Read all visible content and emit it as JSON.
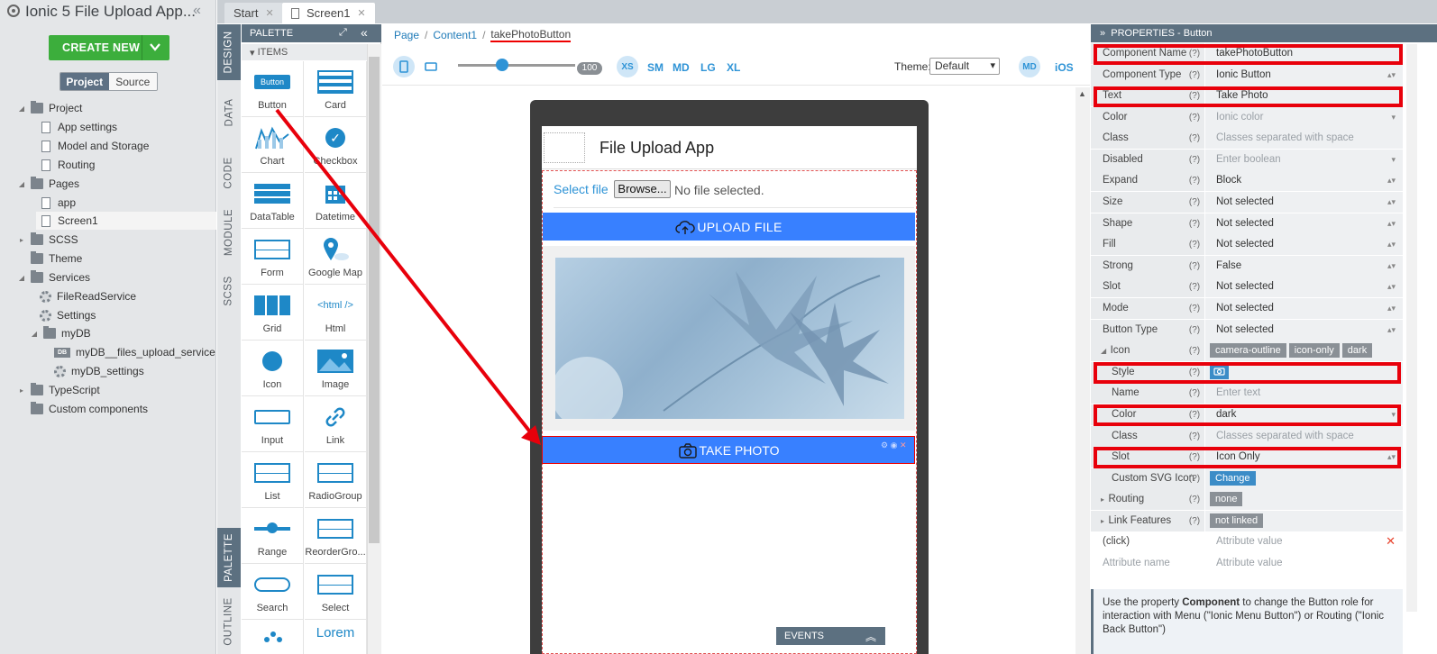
{
  "project": {
    "title": "Ionic 5 File Upload App...",
    "create_new": "CREATE NEW",
    "tab_project": "Project",
    "tab_source": "Source",
    "tree": [
      {
        "label": "Project",
        "icon": "folder-icon",
        "expanded": true
      },
      {
        "label": "App settings",
        "icon": "file-icon"
      },
      {
        "label": "Model and Storage",
        "icon": "file-icon"
      },
      {
        "label": "Routing",
        "icon": "file-icon"
      },
      {
        "label": "Pages",
        "icon": "folder-icon",
        "expanded": true
      },
      {
        "label": "app",
        "icon": "file-icon"
      },
      {
        "label": "Screen1",
        "icon": "file-icon",
        "selected": true
      },
      {
        "label": "SCSS",
        "icon": "folder-icon"
      },
      {
        "label": "Theme",
        "icon": "folder-icon"
      },
      {
        "label": "Services",
        "icon": "folder-icon",
        "expanded": true
      },
      {
        "label": "FileReadService",
        "icon": "gear-icon"
      },
      {
        "label": "Settings",
        "icon": "gear-icon"
      },
      {
        "label": "myDB",
        "icon": "folder-icon",
        "expanded": true
      },
      {
        "label": "myDB__files_upload_service",
        "icon": "db-icon",
        "badge": "DB"
      },
      {
        "label": "myDB_settings",
        "icon": "gear-icon"
      },
      {
        "label": "TypeScript",
        "icon": "folder-icon"
      },
      {
        "label": "Custom components",
        "icon": "folder-icon"
      }
    ]
  },
  "tabs": [
    {
      "label": "Start"
    },
    {
      "label": "Screen1"
    }
  ],
  "vtabs": {
    "design": "DESIGN",
    "data": "DATA",
    "code": "CODE",
    "module": "MODULE",
    "scss": "SCSS",
    "palette": "PALETTE",
    "outline": "OUTLINE"
  },
  "palette": {
    "title": "PALETTE",
    "items_header": "ITEMS",
    "button_pic": "Button",
    "html_pic": "<html />",
    "lorem": "Lorem",
    "items": [
      "Button",
      "Card",
      "Chart",
      "Checkbox",
      "DataTable",
      "Datetime",
      "Form",
      "Google Map",
      "Grid",
      "Html",
      "Icon",
      "Image",
      "Input",
      "Link",
      "List",
      "RadioGroup",
      "Range",
      "ReorderGro...",
      "Search",
      "Select"
    ]
  },
  "breadcrumb": [
    "Page",
    "Content1",
    "takePhotoButton"
  ],
  "toolbar": {
    "zoom": "100",
    "sizes": [
      "XS",
      "SM",
      "MD",
      "LG",
      "XL"
    ],
    "theme_label": "Theme:",
    "theme_value": "Default",
    "mode_md": "MD",
    "mode_ios": "iOS"
  },
  "preview": {
    "header_title": "File Upload App",
    "select_file": "Select file",
    "browse": "Browse...",
    "no_file": "No file selected.",
    "upload_button": "UPLOAD FILE",
    "take_photo_button": "TAKE PHOTO",
    "events": "EVENTS"
  },
  "properties": {
    "title": "PROPERTIES - Button",
    "rows": [
      {
        "label": "Component Name",
        "value": "takePhotoButton"
      },
      {
        "label": "Component Type",
        "value": "Ionic Button"
      },
      {
        "label": "Text",
        "value": "Take Photo"
      },
      {
        "label": "Color",
        "value": "Ionic color"
      },
      {
        "label": "Class",
        "value": "Classes separated with space"
      },
      {
        "label": "Disabled",
        "value": "Enter boolean"
      },
      {
        "label": "Expand",
        "value": "Block"
      },
      {
        "label": "Size",
        "value": "Not selected"
      },
      {
        "label": "Shape",
        "value": "Not selected"
      },
      {
        "label": "Fill",
        "value": "Not selected"
      },
      {
        "label": "Strong",
        "value": "False"
      },
      {
        "label": "Slot",
        "value": "Not selected"
      },
      {
        "label": "Mode",
        "value": "Not selected"
      },
      {
        "label": "Button Type",
        "value": "Not selected"
      },
      {
        "label": "Icon",
        "tags": [
          "camera-outline",
          "icon-only",
          "dark"
        ]
      },
      {
        "label": "Style",
        "value": ""
      },
      {
        "label": "Name",
        "value": "Enter text"
      },
      {
        "label": "Color",
        "value": "dark"
      },
      {
        "label": "Class",
        "value": "Classes separated with space"
      },
      {
        "label": "Slot",
        "value": "Icon Only"
      },
      {
        "label": "Custom SVG Icon",
        "tags": [
          "Change"
        ]
      },
      {
        "label": "Routing",
        "tags": [
          "none"
        ]
      },
      {
        "label": "Link Features",
        "tags": [
          "not linked"
        ]
      },
      {
        "label": "(click)",
        "value": "Attribute value"
      },
      {
        "label": "Attribute name",
        "value": "Attribute value"
      }
    ],
    "tip_part1": "Use the property ",
    "tip_bold": "Component",
    "tip_part2": " to change the Button role for interaction with Menu (\"Ionic Menu Button\") or Routing (\"Ionic Back Button\")"
  }
}
